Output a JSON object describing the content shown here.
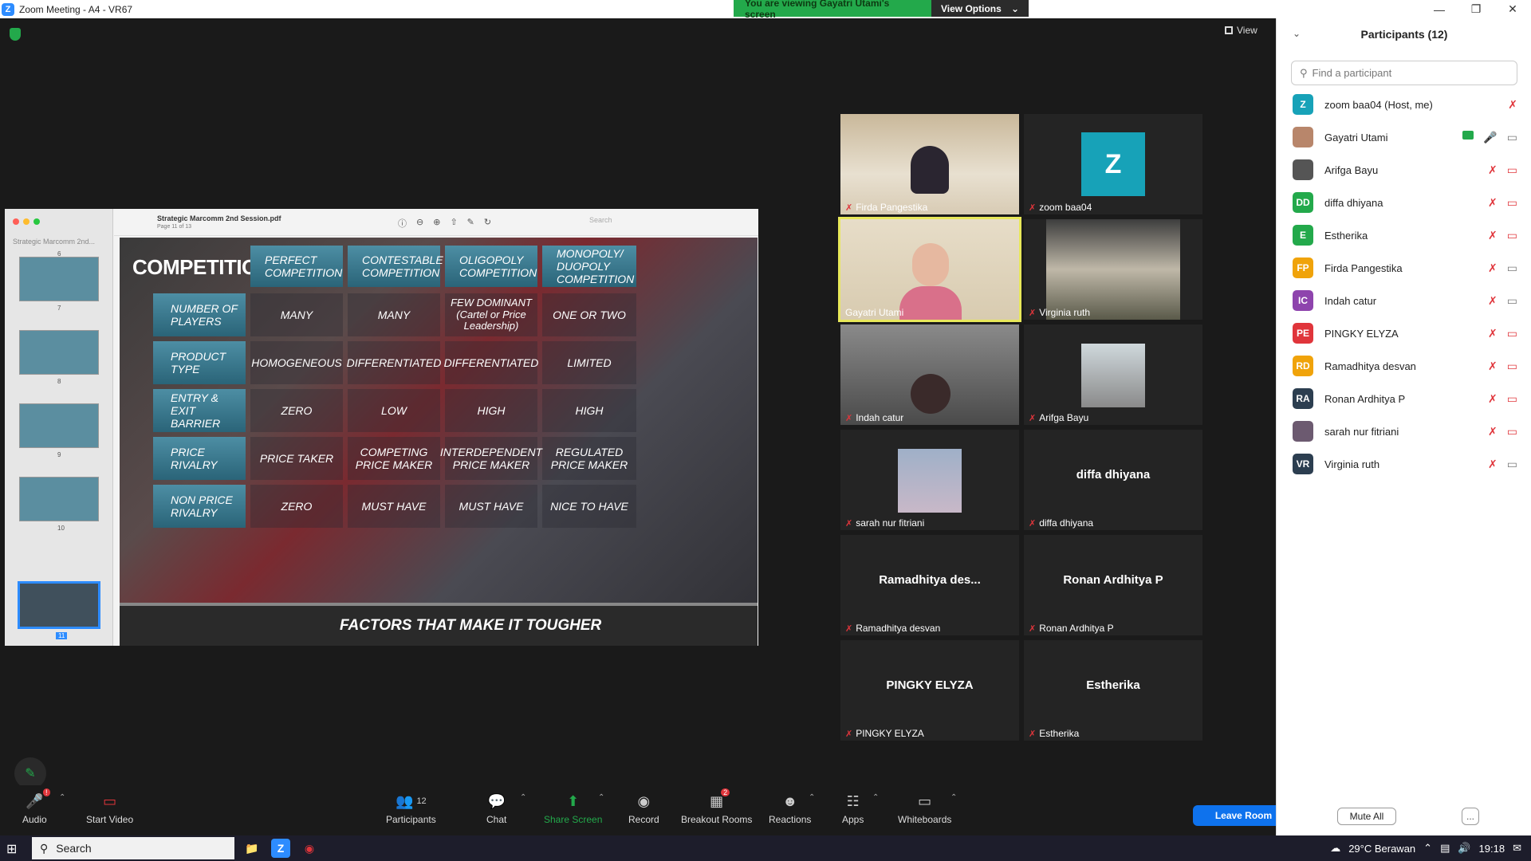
{
  "window": {
    "title": "Zoom Meeting - A4 - VR67",
    "logo_letter": "Z"
  },
  "banner": {
    "text": "You are viewing Gayatri Utami's screen",
    "options_label": "View Options"
  },
  "view_button": "View",
  "shared": {
    "doc_short": "Strategic Marcomm 2nd...",
    "file_name": "Strategic Marcomm 2nd Session.pdf",
    "page_info": "Page 11 of 13",
    "search_placeholder": "Search",
    "thumb_numbers": [
      "6",
      "7",
      "8",
      "9",
      "10",
      "11"
    ],
    "slide": {
      "title": "COMPETITION",
      "headers": [
        "PERFECT COMPETITION",
        "CONTESTABLE COMPETITION",
        "OLIGOPOLY COMPETITION",
        "MONOPOLY/ DUOPOLY COMPETITION"
      ],
      "rows": [
        {
          "label": "NUMBER OF PLAYERS",
          "values": [
            "MANY",
            "MANY",
            "FEW DOMINANT (Cartel or Price Leadership)",
            "ONE OR TWO"
          ]
        },
        {
          "label": "PRODUCT TYPE",
          "values": [
            "HOMOGENEOUS",
            "DIFFERENTIATED",
            "DIFFERENTIATED",
            "LIMITED"
          ]
        },
        {
          "label": "ENTRY & EXIT BARRIER",
          "values": [
            "ZERO",
            "LOW",
            "HIGH",
            "HIGH"
          ]
        },
        {
          "label": "PRICE RIVALRY",
          "values": [
            "PRICE TAKER",
            "COMPETING PRICE MAKER",
            "INTERDEPENDENT PRICE MAKER",
            "REGULATED PRICE MAKER"
          ]
        },
        {
          "label": "NON PRICE RIVALRY",
          "values": [
            "ZERO",
            "MUST HAVE",
            "MUST HAVE",
            "NICE TO HAVE"
          ]
        }
      ],
      "footer": "FACTORS THAT MAKE IT TOUGHER"
    }
  },
  "tiles": [
    {
      "name": "Firda Pangestika",
      "type": "video"
    },
    {
      "name": "zoom baa04",
      "type": "avatar",
      "letter": "Z"
    },
    {
      "name": "Gayatri Utami",
      "type": "video",
      "active": true
    },
    {
      "name": "Virginia ruth",
      "type": "video"
    },
    {
      "name": "Indah catur",
      "type": "video"
    },
    {
      "name": "Arifga Bayu",
      "type": "video"
    },
    {
      "name": "sarah nur fitriani",
      "type": "video"
    },
    {
      "name": "diffa dhiyana",
      "type": "text",
      "display": "diffa dhiyana"
    },
    {
      "name": "Ramadhitya desvan",
      "type": "text",
      "display": "Ramadhitya  des..."
    },
    {
      "name": "Ronan Ardhitya P",
      "type": "text",
      "display": "Ronan Ardhitya P"
    },
    {
      "name": "PINGKY ELYZA",
      "type": "text",
      "display": "PINGKY ELYZA"
    },
    {
      "name": "Estherika",
      "type": "text",
      "display": "Estherika"
    }
  ],
  "toolbar": {
    "audio": "Audio",
    "start_video": "Start Video",
    "participants": "Participants",
    "participants_count": "12",
    "chat": "Chat",
    "share_screen": "Share Screen",
    "record": "Record",
    "breakout": "Breakout Rooms",
    "breakout_badge": "2",
    "reactions": "Reactions",
    "apps": "Apps",
    "whiteboards": "Whiteboards",
    "leave": "Leave Room"
  },
  "panel": {
    "title": "Participants (12)",
    "find_placeholder": "Find a participant",
    "participants": [
      {
        "initials": "Z",
        "name": "zoom baa04 (Host, me)",
        "color": "#17a2b8"
      },
      {
        "initials": "",
        "name": "Gayatri Utami",
        "color": "#b8866b"
      },
      {
        "initials": "",
        "name": "Arifga Bayu",
        "color": "#555555"
      },
      {
        "initials": "DD",
        "name": "diffa dhiyana",
        "color": "#23a94b"
      },
      {
        "initials": "E",
        "name": "Estherika",
        "color": "#23a94b"
      },
      {
        "initials": "FP",
        "name": "Firda Pangestika",
        "color": "#f0a30a"
      },
      {
        "initials": "IC",
        "name": "Indah catur",
        "color": "#8e44ad"
      },
      {
        "initials": "PE",
        "name": "PINGKY ELYZA",
        "color": "#e0353b"
      },
      {
        "initials": "RD",
        "name": "Ramadhitya desvan",
        "color": "#f0a30a"
      },
      {
        "initials": "RA",
        "name": "Ronan Ardhitya P",
        "color": "#2c3e50"
      },
      {
        "initials": "",
        "name": "sarah nur fitriani",
        "color": "#6c5a70"
      },
      {
        "initials": "VR",
        "name": "Virginia ruth",
        "color": "#2c3e50"
      }
    ],
    "mute_all": "Mute All",
    "more": "..."
  },
  "taskbar": {
    "search": "Search",
    "weather": "29°C  Berawan",
    "time": "19:18"
  }
}
